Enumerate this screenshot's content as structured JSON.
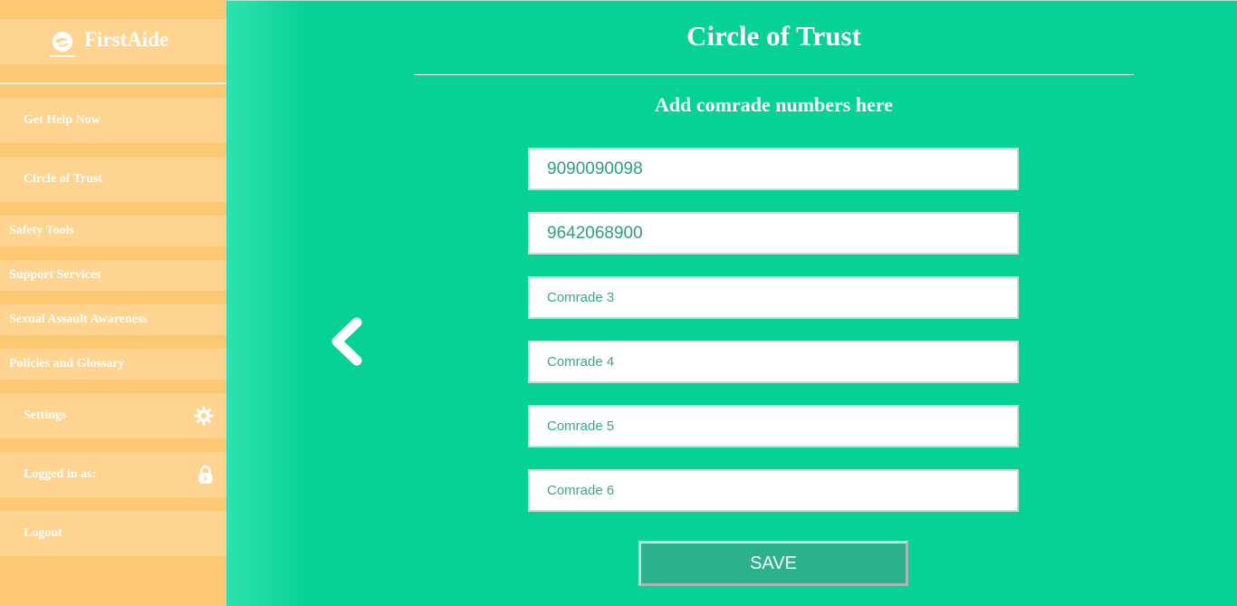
{
  "brand": {
    "name": "FirstAide",
    "logo_icon": "firstaide-logo-icon"
  },
  "sidebar": {
    "items": [
      {
        "label": "Get Help Now"
      },
      {
        "label": "Circle of Trust"
      },
      {
        "label": "Safety Tools"
      },
      {
        "label": "Support Services"
      },
      {
        "label": "Sexual Assault Awareness"
      },
      {
        "label": "Policies and Glossary"
      },
      {
        "label": "Settings",
        "icon": "gear-icon"
      },
      {
        "label": "Logged in as:",
        "icon": "lock-icon"
      },
      {
        "label": "Logout"
      }
    ]
  },
  "main": {
    "title": "Circle of Trust",
    "subtitle": "Add comrade numbers here",
    "fields": [
      {
        "value": "9090090098",
        "placeholder": ""
      },
      {
        "value": "9642068900",
        "placeholder": ""
      },
      {
        "value": "",
        "placeholder": "Comrade 3"
      },
      {
        "value": "",
        "placeholder": "Comrade 4"
      },
      {
        "value": "",
        "placeholder": "Comrade 5"
      },
      {
        "value": "",
        "placeholder": "Comrade 6"
      }
    ],
    "save_label": "SAVE",
    "back_icon": "chevron-left-icon"
  },
  "colors": {
    "accent": "#07d295",
    "sidebar": "#fdc874",
    "sidebar_item": "#ffd490",
    "button": "#2bb28c",
    "field_text": "#2e9f84"
  }
}
